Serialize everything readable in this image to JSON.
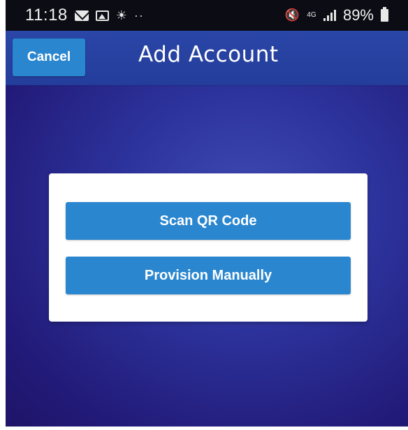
{
  "status_bar": {
    "time": "11:18",
    "battery": "89%",
    "lte_label": "4G",
    "icons": [
      "mail-icon",
      "image-icon",
      "weather-icon",
      "more-dots-icon",
      "mute-icon",
      "lte-icon",
      "signal-icon",
      "battery-icon"
    ]
  },
  "header": {
    "cancel_label": "Cancel",
    "title": "Add Account"
  },
  "card": {
    "scan_label": "Scan QR Code",
    "manual_label": "Provision Manually"
  },
  "colors": {
    "accent_button": "#2a86cf",
    "header_bg": "#2a46a6",
    "background": "#2c329b"
  }
}
